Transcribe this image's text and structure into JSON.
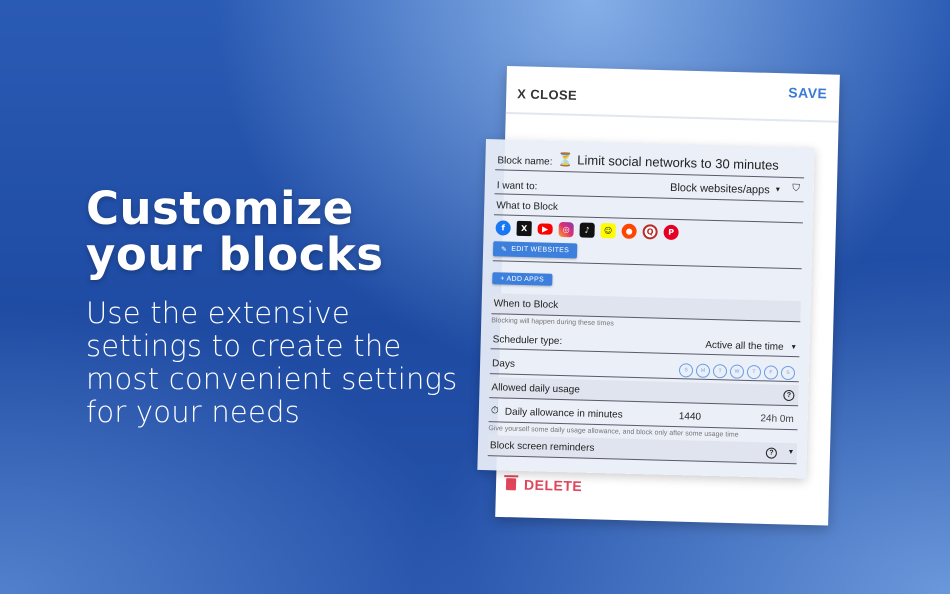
{
  "hero": {
    "title_line1": "Customize",
    "title_line2": "your blocks",
    "subtitle": "Use the extensive settings to create the most convenient settings for your needs"
  },
  "editor": {
    "close_label": "X CLOSE",
    "save_label": "SAVE",
    "delete_label": "DELETE",
    "block_name_label": "Block name:",
    "block_name_value": "⏳ Limit social networks to 30 minutes",
    "want_label": "I want to:",
    "want_value": "Block websites/apps",
    "what_to_block": "What to Block",
    "app_icons": [
      "facebook-icon",
      "x-icon",
      "youtube-icon",
      "instagram-icon",
      "tiktok-icon",
      "snapchat-icon",
      "reddit-icon",
      "quora-icon",
      "pinterest-icon"
    ],
    "edit_websites": "EDIT WEBSITES",
    "add_apps": "+ ADD APPS",
    "when_to_block": "When to Block",
    "when_note": "Blocking will happen during these times",
    "scheduler_label": "Scheduler type:",
    "scheduler_value": "Active all the time",
    "days_label": "Days",
    "days": [
      "S",
      "M",
      "T",
      "W",
      "T",
      "F",
      "S"
    ],
    "allowed_usage": "Allowed daily usage",
    "daily_allowance_label": "Daily allowance in minutes",
    "daily_allowance_minutes": "1440",
    "daily_allowance_hours": "24h 0m",
    "allowance_note": "Give yourself some daily usage allowance, and block only after some usage time",
    "reminders_label": "Block screen reminders"
  },
  "colors": {
    "accent": "#3a7bd5",
    "danger": "#e0455a",
    "background": "#2250a8"
  }
}
